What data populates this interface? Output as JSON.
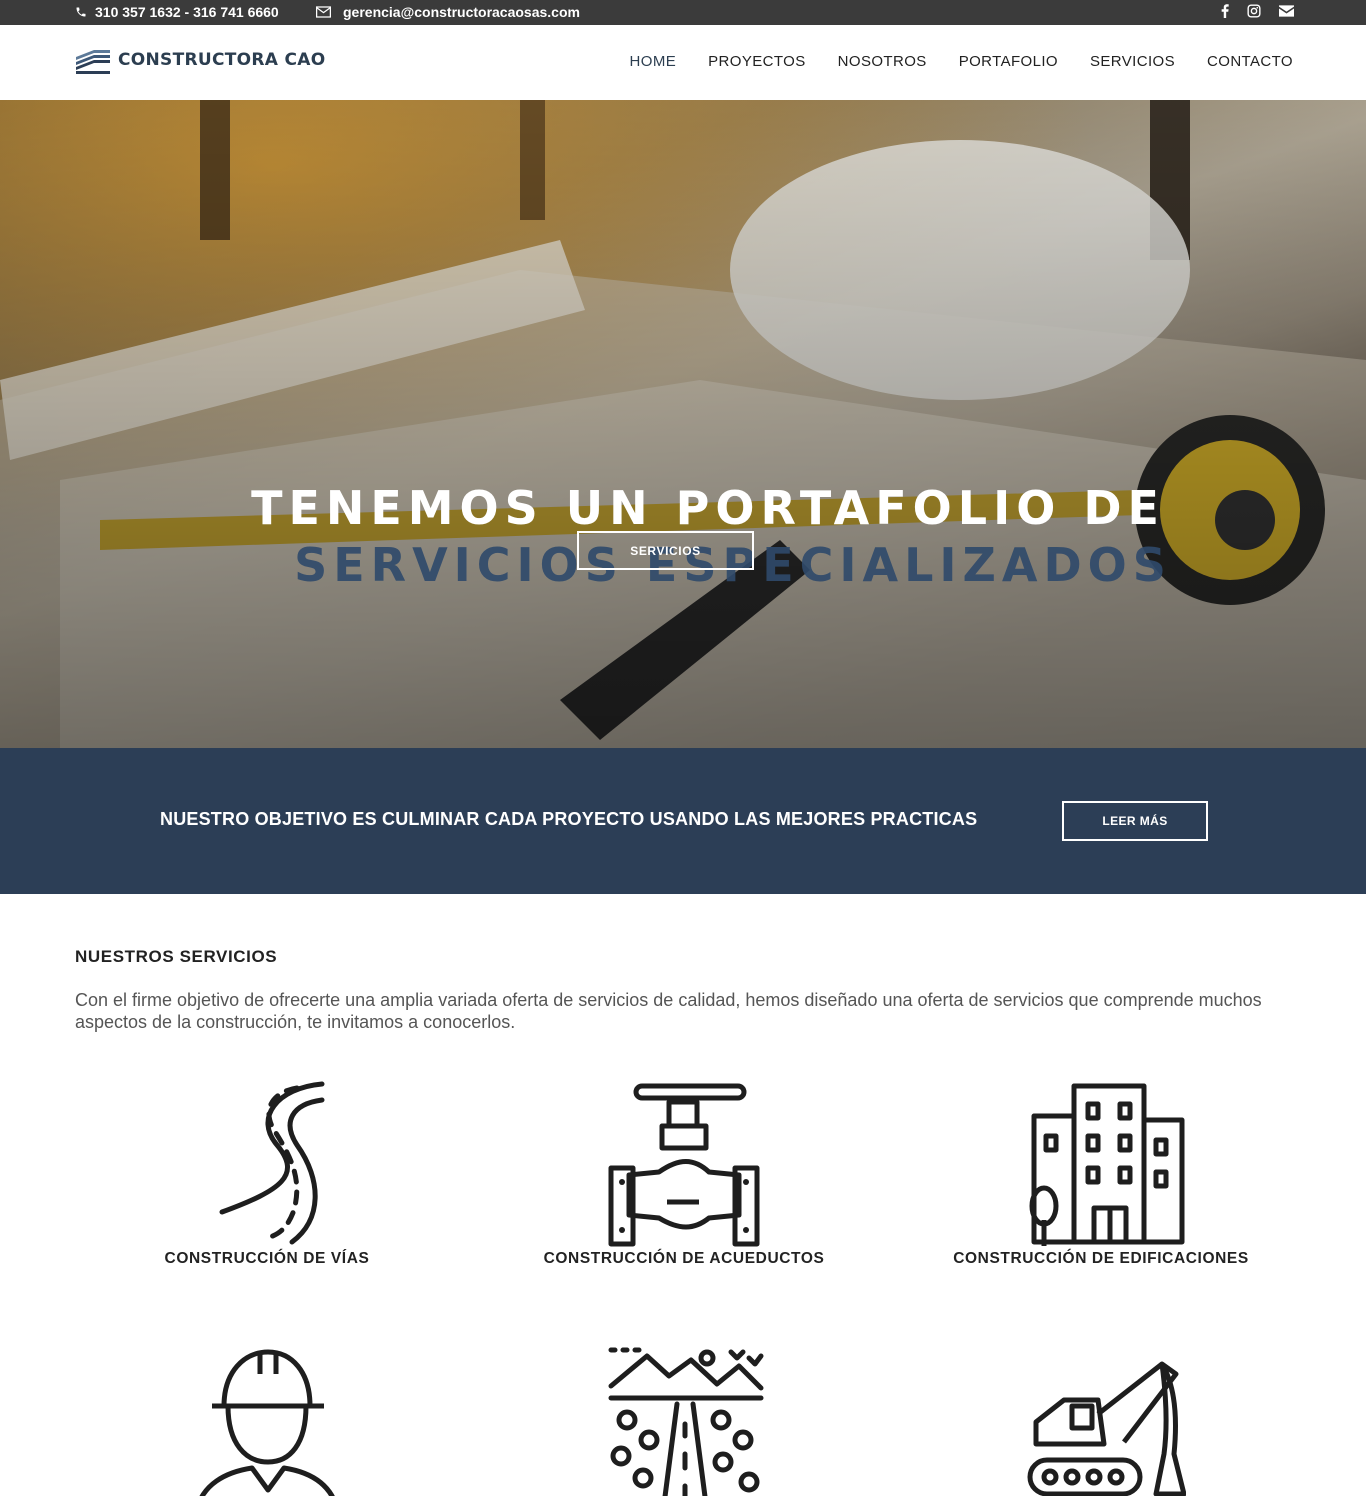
{
  "topbar": {
    "phone": "310 357 1632 - 316 741 6660",
    "email": "gerencia@constructoracaosas.com",
    "social": [
      "facebook-icon",
      "instagram-icon",
      "envelope-icon"
    ]
  },
  "header": {
    "logo_text": "CONSTRUCTORA CAO",
    "nav": [
      "HOME",
      "PROYECTOS",
      "NOSOTROS",
      "PORTAFOLIO",
      "SERVICIOS",
      "CONTACTO"
    ],
    "active": "HOME"
  },
  "hero": {
    "title_line1": "TENEMOS UN PORTAFOLIO DE",
    "title_line2": "SERVICIOS ESPECIALIZADOS",
    "button": "SERVICIOS"
  },
  "banner": {
    "text": "NUESTRO OBJETIVO ES CULMINAR CADA PROYECTO USANDO LAS MEJORES PRACTICAS",
    "button": "LEER MÁS"
  },
  "services": {
    "heading": "NUESTROS SERVICIOS",
    "intro": "Con el firme objetivo de ofrecerte una amplia variada oferta de servicios de calidad, hemos diseñado una oferta de servicios que comprende muchos aspectos de la construcción, te invitamos a conocerlos.",
    "items": [
      {
        "label": "CONSTRUCCIÓN DE VÍAS",
        "icon": "road-icon"
      },
      {
        "label": "CONSTRUCCIÓN DE ACUEDUCTOS",
        "icon": "valve-pipe-icon"
      },
      {
        "label": "CONSTRUCCIÓN DE EDIFICACIONES",
        "icon": "buildings-icon"
      },
      {
        "label": "",
        "icon": "engineer-icon"
      },
      {
        "label": "",
        "icon": "landscape-road-icon"
      },
      {
        "label": "",
        "icon": "excavator-icon"
      }
    ]
  },
  "colors": {
    "topbar": "#3b3b3b",
    "brand": "#2c3e56",
    "hero_accent": "#2f4a6b"
  }
}
